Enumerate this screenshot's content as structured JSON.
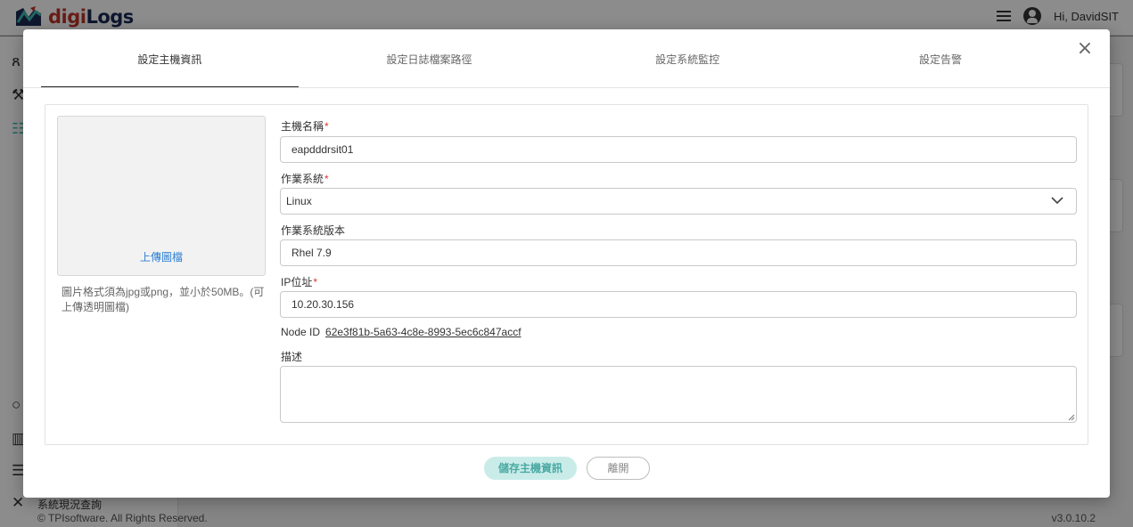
{
  "app": {
    "logo_text_a": "digi",
    "logo_text_b": "Logs",
    "greeting": "Hi, DavidSIT",
    "footer_menu_item": "系統現況查詢",
    "copyright": "© TPIsoftware. All Rights Reserved.",
    "version": "v3.0.10.2"
  },
  "modal": {
    "tabs": [
      {
        "label": "設定主機資訊",
        "active": true
      },
      {
        "label": "設定日誌檔案路徑",
        "active": false
      },
      {
        "label": "設定系統監控",
        "active": false
      },
      {
        "label": "設定告警",
        "active": false
      }
    ],
    "close_glyph": "×",
    "upload": {
      "link_label": "上傳圖檔",
      "hint": "圖片格式須為jpg或png，並小於50MB。(可上傳透明圖檔)"
    },
    "fields": {
      "hostname": {
        "label": "主機名稱",
        "required_mark": "*",
        "value": "eapdddrsit01"
      },
      "os": {
        "label": "作業系統",
        "required_mark": "*",
        "value": "Linux"
      },
      "os_version": {
        "label": "作業系統版本",
        "value": "Rhel 7.9"
      },
      "ip": {
        "label": "IP位址",
        "required_mark": "*",
        "value": "10.20.30.156"
      },
      "node_id": {
        "label": "Node ID",
        "value": "62e3f81b-5a63-4c8e-8993-5ec6c847accf"
      },
      "description": {
        "label": "描述",
        "value": ""
      }
    },
    "buttons": {
      "save": "儲存主機資訊",
      "leave": "離開"
    }
  },
  "colors": {
    "accent_red": "#d43a2f",
    "link_blue": "#2d7fd3",
    "save_bg": "#c9ece9",
    "save_text": "#4aa9a3"
  }
}
